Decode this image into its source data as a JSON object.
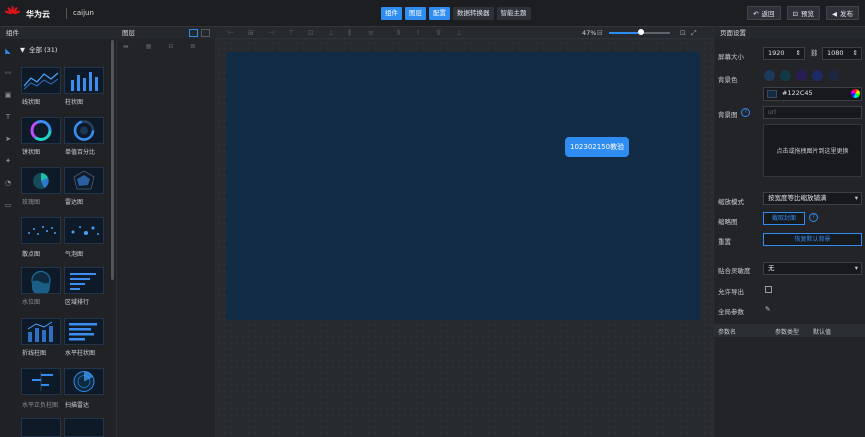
{
  "topbar": {
    "brand": "华为云",
    "project": "caijun",
    "tabs": [
      {
        "label": "组件",
        "active": true
      },
      {
        "label": "图层",
        "active": true
      },
      {
        "label": "配置",
        "active": true
      },
      {
        "label": "数据转换器",
        "active": false
      },
      {
        "label": "智能主题",
        "active": false
      }
    ],
    "back_label": "返回",
    "preview_label": "预览",
    "publish_label": "发布"
  },
  "components": {
    "title": "组件",
    "category": "全部 (31)",
    "items": [
      {
        "label": "线状图",
        "icon": "line-chart-icon",
        "dim": false
      },
      {
        "label": "柱状图",
        "icon": "bar-chart-icon",
        "dim": false
      },
      {
        "label": "饼状图",
        "icon": "pie-chart-icon",
        "dim": false
      },
      {
        "label": "单值百分比",
        "icon": "percent-ring-icon",
        "dim": false
      },
      {
        "label": "玫瑰图",
        "icon": "rose-chart-icon",
        "dim": true
      },
      {
        "label": "雷达图",
        "icon": "radar-chart-icon",
        "dim": false
      },
      {
        "label": "散点图",
        "icon": "scatter-chart-icon",
        "dim": false
      },
      {
        "label": "气泡图",
        "icon": "bubble-chart-icon",
        "dim": false
      },
      {
        "label": "水位图",
        "icon": "liquid-fill-icon",
        "dim": true
      },
      {
        "label": "区域排行",
        "icon": "ranking-icon",
        "dim": false
      },
      {
        "label": "折线柱图",
        "icon": "line-bar-icon",
        "dim": false
      },
      {
        "label": "水平柱状图",
        "icon": "horizontal-bar-icon",
        "dim": false
      },
      {
        "label": "水平正负柱图",
        "icon": "posneg-bar-icon",
        "dim": true
      },
      {
        "label": "扫描雷达",
        "icon": "scan-radar-icon",
        "dim": false
      }
    ]
  },
  "layers": {
    "title": "图层"
  },
  "canvas_toolbar": {
    "zoom": "47%"
  },
  "canvas": {
    "chip_label": "102302150教验",
    "background": "#122C45"
  },
  "props": {
    "title": "页面设置",
    "screen_size_label": "屏幕大小",
    "width": "1920",
    "height": "1080",
    "bg_color_label": "背景色",
    "swatches": [
      "#1d3a5c",
      "#123a45",
      "#2a1d55",
      "#1e2a66",
      "#1c2740"
    ],
    "color_value": "#122C45",
    "bg_image_label": "背景图",
    "url_placeholder": "url",
    "upload_text": "点击或拖拽图片到这里更换",
    "scale_label": "缩放模式",
    "scale_value": "按宽度等比缩放铺满",
    "thumb_label": "缩略图",
    "capture_label": "截取封面",
    "reset_label": "重置",
    "restore_label": "恢复默认背景",
    "snap_label": "贴合灵敏度",
    "snap_value": "无",
    "export_label": "允许导出",
    "global_label": "全局参数",
    "table_headers": [
      "参数名",
      "参数类型",
      "默认值"
    ]
  }
}
